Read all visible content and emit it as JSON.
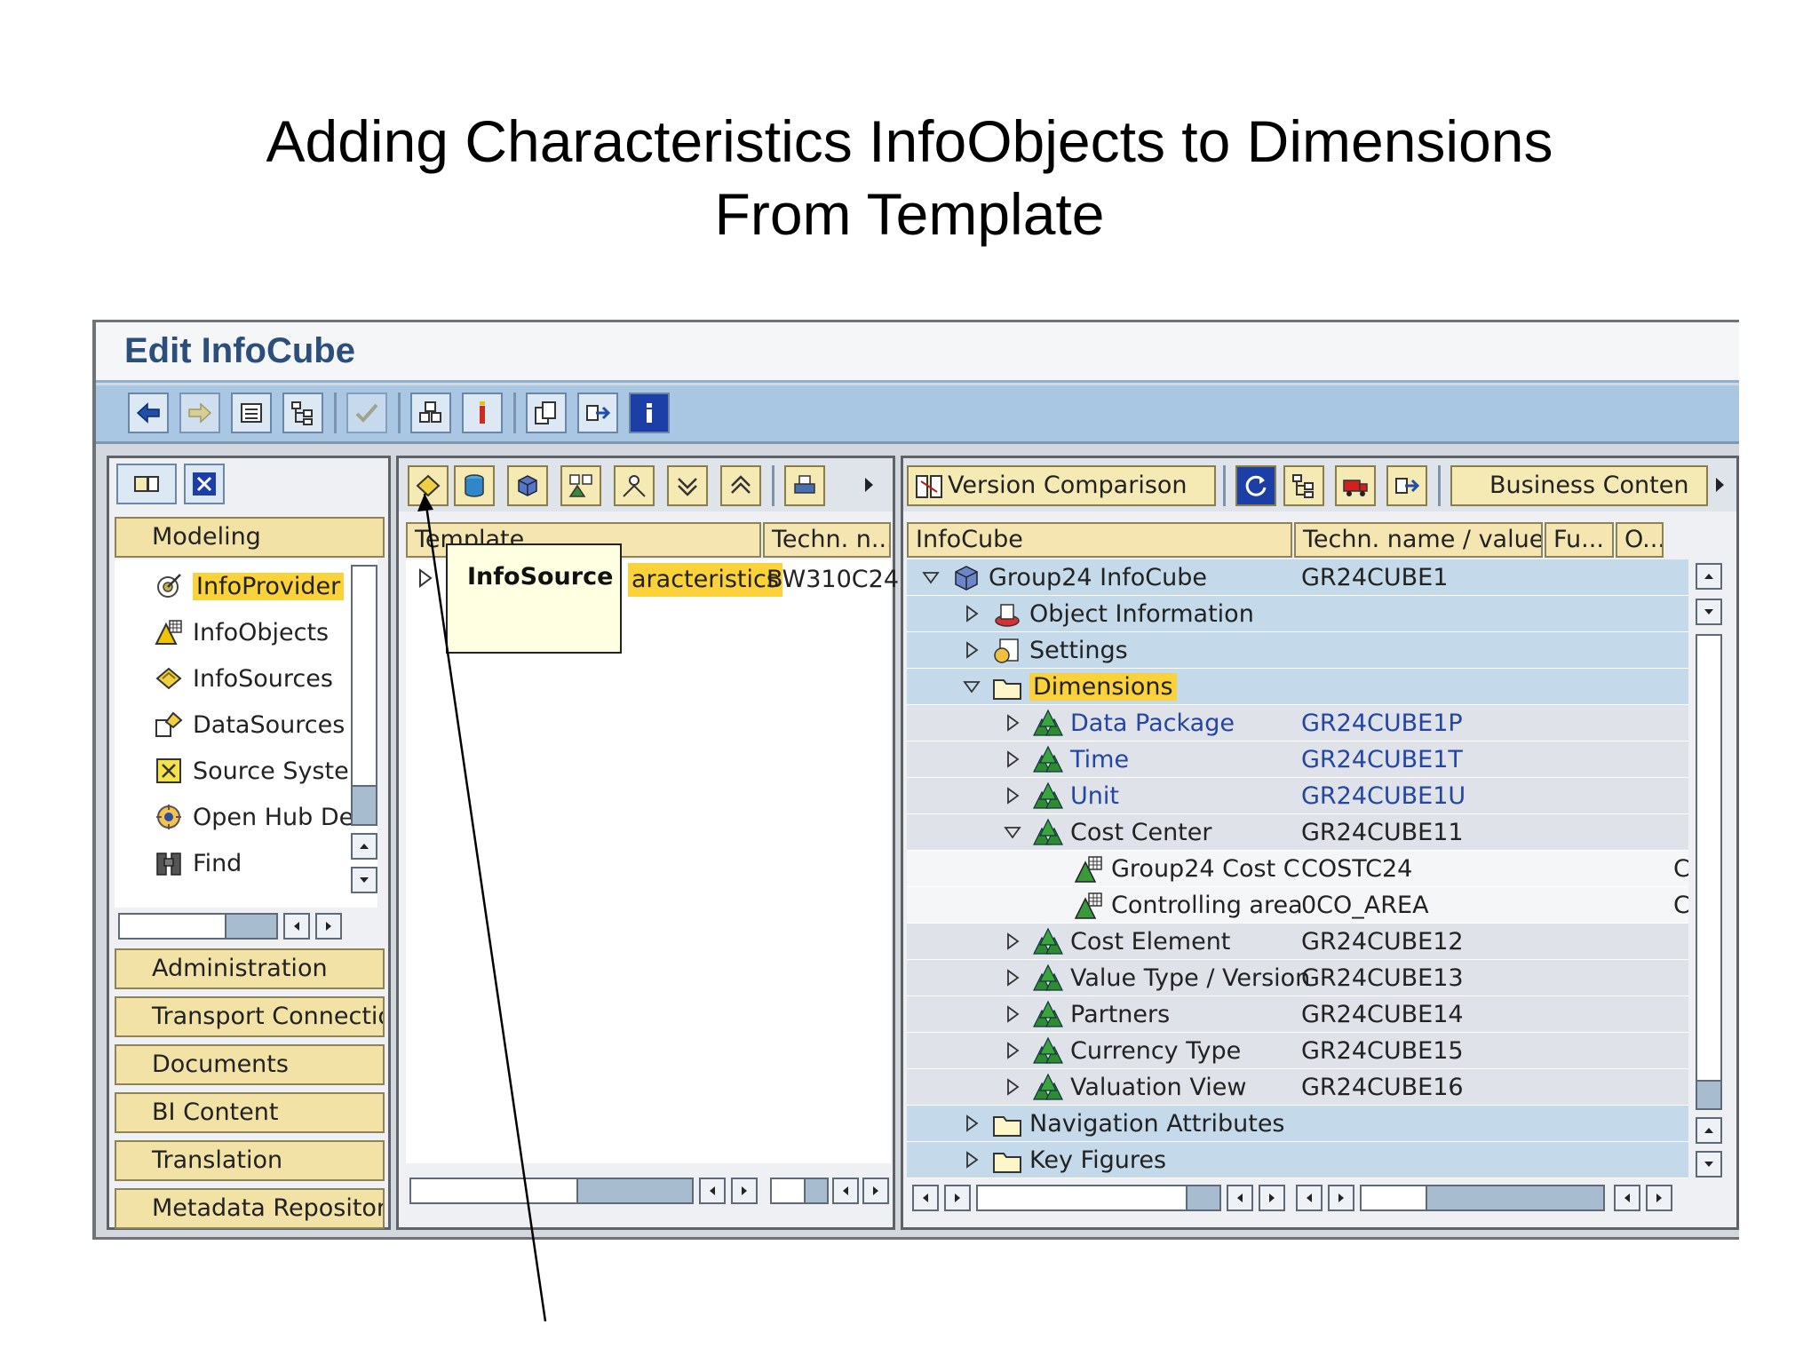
{
  "slide": {
    "title_line1": "Adding Characteristics InfoObjects to Dimensions",
    "title_line2": "From Template"
  },
  "window": {
    "title": "Edit InfoCube"
  },
  "toolbar": {
    "icons": [
      "back-arrow-icon",
      "forward-arrow-icon",
      "display-list-icon",
      "hierarchy-icon",
      "check-icon",
      "activate-icon",
      "info-marker-icon",
      "copy-icon",
      "transfer-icon",
      "info-icon"
    ]
  },
  "navigator": {
    "sections": [
      "Modeling",
      "Administration",
      "Transport Connectio",
      "Documents",
      "BI Content",
      "Translation",
      "Metadata Repository"
    ],
    "modeling_items": [
      {
        "label": "InfoProvider",
        "icon": "infoprovider-icon",
        "selected": true
      },
      {
        "label": "InfoObjects",
        "icon": "infoobject-icon"
      },
      {
        "label": "InfoSources",
        "icon": "infosource-icon"
      },
      {
        "label": "DataSources",
        "icon": "datasource-icon"
      },
      {
        "label": "Source Syste",
        "icon": "source-system-icon"
      },
      {
        "label": "Open Hub De",
        "icon": "open-hub-icon"
      },
      {
        "label": "Find",
        "icon": "binoculars-icon"
      }
    ]
  },
  "template_panel": {
    "columns": [
      "Template",
      "Techn. n..."
    ],
    "row": {
      "label": "aracteristics",
      "tech": "BW310C24"
    },
    "tooltip": "InfoSource"
  },
  "cube_panel": {
    "toolbar": {
      "version_comparison": "Version Comparison",
      "business_content": "Business Conten"
    },
    "columns": [
      "InfoCube",
      "Techn. name / value",
      "Fu...",
      "O..."
    ],
    "rows": [
      {
        "label": "Group24 InfoCube",
        "value": "GR24CUBE1",
        "level": 0,
        "expanded": true,
        "icon": "infocube-icon"
      },
      {
        "label": "Object Information",
        "value": "",
        "level": 1,
        "expanded": false,
        "icon": "object-info-icon"
      },
      {
        "label": "Settings",
        "value": "",
        "level": 1,
        "expanded": false,
        "icon": "settings-icon"
      },
      {
        "label": "Dimensions",
        "value": "",
        "level": 1,
        "expanded": true,
        "icon": "folder-icon",
        "highlight": true
      },
      {
        "label": "Data Package",
        "value": "GR24CUBE1P",
        "level": 2,
        "expanded": false,
        "icon": "dimension-icon",
        "blue": true
      },
      {
        "label": "Time",
        "value": "GR24CUBE1T",
        "level": 2,
        "expanded": false,
        "icon": "dimension-icon",
        "blue": true
      },
      {
        "label": "Unit",
        "value": "GR24CUBE1U",
        "level": 2,
        "expanded": false,
        "icon": "dimension-icon",
        "blue": true
      },
      {
        "label": "Cost Center",
        "value": "GR24CUBE11",
        "level": 2,
        "expanded": true,
        "icon": "dimension-icon"
      },
      {
        "label": "Group24 Cost C",
        "value": "COSTC24",
        "level": 3,
        "icon": "infoobject-icon",
        "extra": "C"
      },
      {
        "label": "Controlling area",
        "value": "0CO_AREA",
        "level": 3,
        "icon": "infoobject-icon",
        "extra": "C"
      },
      {
        "label": "Cost Element",
        "value": "GR24CUBE12",
        "level": 2,
        "expanded": false,
        "icon": "dimension-icon"
      },
      {
        "label": "Value Type / Version",
        "value": "GR24CUBE13",
        "level": 2,
        "expanded": false,
        "icon": "dimension-icon"
      },
      {
        "label": "Partners",
        "value": "GR24CUBE14",
        "level": 2,
        "expanded": false,
        "icon": "dimension-icon"
      },
      {
        "label": "Currency Type",
        "value": "GR24CUBE15",
        "level": 2,
        "expanded": false,
        "icon": "dimension-icon"
      },
      {
        "label": "Valuation View",
        "value": "GR24CUBE16",
        "level": 2,
        "expanded": false,
        "icon": "dimension-icon"
      },
      {
        "label": "Navigation Attributes",
        "value": "",
        "level": 1,
        "expanded": false,
        "icon": "folder-icon"
      },
      {
        "label": "Key Figures",
        "value": "",
        "level": 1,
        "expanded": false,
        "icon": "folder-icon"
      }
    ]
  },
  "colors": {
    "toolbar_bg": "#a9c6e3",
    "header_yellow": "#f2e2a6",
    "selection_yellow": "#fbd23a",
    "row_blue": "#c4d9ea",
    "row_gray": "#dfe3e9",
    "row_white": "#f5f6f8",
    "link_blue": "#2446a3"
  }
}
